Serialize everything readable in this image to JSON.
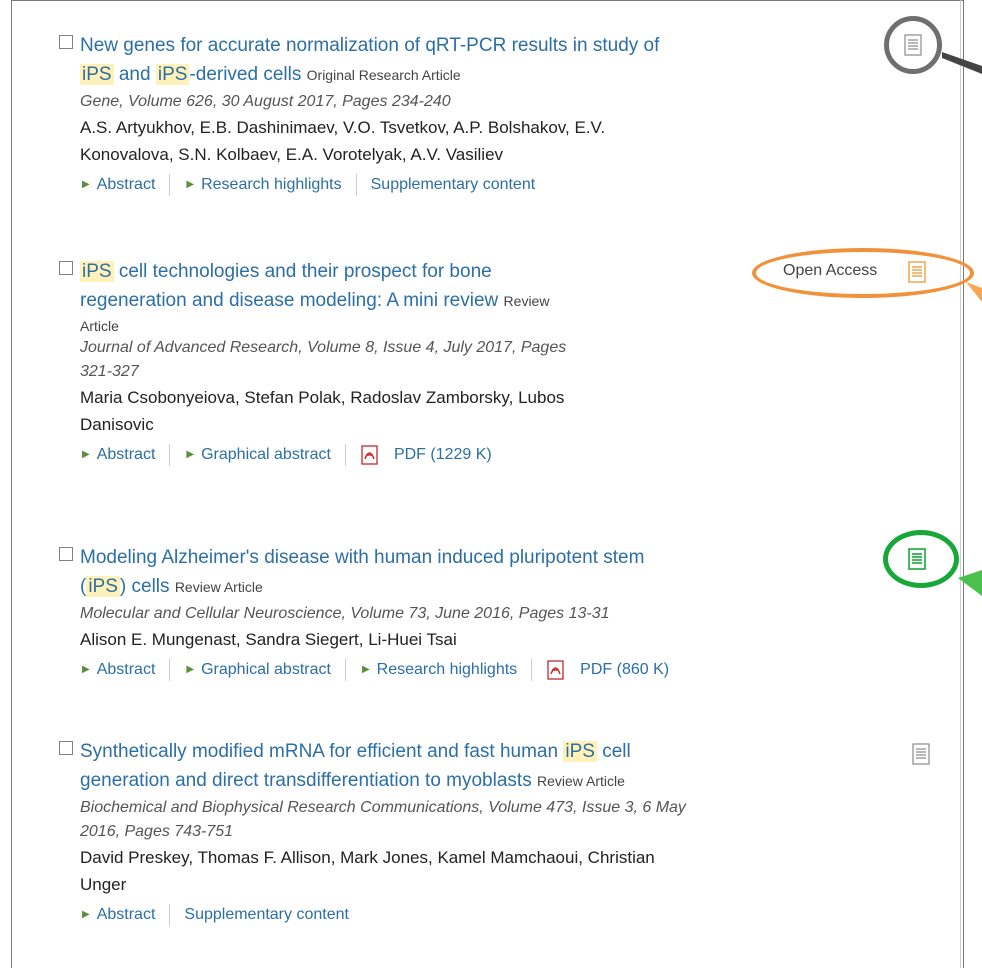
{
  "articles": [
    {
      "title_parts": [
        "New genes for accurate normalization of qRT-PCR results in study of",
        "iPS",
        " and ",
        "iPS",
        "-derived cells"
      ],
      "type": "Original Research Article",
      "source": "Gene, Volume 626, 30 August 2017, Pages 234-240",
      "authors_line1": "A.S. Artyukhov, E.B. Dashinimaev, V.O. Tsvetkov, A.P. Bolshakov, E.V.",
      "authors_line2": "Konovalova, S.N. Kolbaev, E.A. Vorotelyak, A.V. Vasiliev",
      "links": [
        "Abstract",
        "Research highlights",
        "Supplementary content"
      ]
    },
    {
      "title_parts": [
        "iPS",
        " cell technologies and their prospect for bone",
        "regeneration and disease modeling: A mini review"
      ],
      "type_line1": "Review",
      "type_line2": "Article",
      "source_line1": "Journal of Advanced Research, Volume 8, Issue 4, July 2017, Pages",
      "source_line2": "321-327",
      "authors_line1": "Maria Csobonyeiova, Stefan Polak, Radoslav Zamborsky, Lubos",
      "authors_line2": "Danisovic",
      "links": [
        "Abstract",
        "Graphical abstract",
        "PDF (1229 K)"
      ],
      "badge": "Open Access"
    },
    {
      "title_parts": [
        "Modeling Alzheimer's disease with human induced pluripotent stem",
        "(",
        "iPS",
        ") cells"
      ],
      "type": "Review Article",
      "source": "Molecular and Cellular Neuroscience, Volume 73, June 2016, Pages 13-31",
      "authors_line1": "Alison E. Mungenast, Sandra Siegert, Li-Huei Tsai",
      "links": [
        "Abstract",
        "Graphical abstract",
        "Research highlights",
        "PDF (860 K)"
      ]
    },
    {
      "title_parts": [
        "Synthetically modified mRNA for efficient and fast human",
        "iPS",
        " cell",
        "generation and direct transdifferentiation to myoblasts"
      ],
      "type": "Review Article",
      "source_line1": "Biochemical and Biophysical Research Communications, Volume 473, Issue 3, 6 May",
      "source_line2": "2016, Pages 743-751",
      "authors_line1": "David Preskey, Thomas F. Allison, Mark Jones, Kamel Mamchaoui, Christian",
      "authors_line2": "Unger",
      "links": [
        "Abstract",
        "Supplementary content"
      ]
    }
  ],
  "colors": {
    "link": "#2b6fa5",
    "highlight": "#fff1b8",
    "ring_gray": "#6f6f6f",
    "ring_orange": "#f0923a",
    "ring_green": "#18a83a"
  }
}
